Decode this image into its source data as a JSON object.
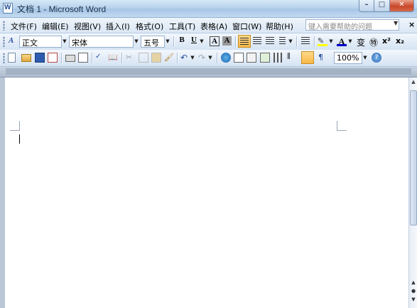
{
  "window": {
    "title": "文档 1 - Microsoft Word"
  },
  "menu": {
    "items": [
      "文件(F)",
      "编辑(E)",
      "视图(V)",
      "插入(I)",
      "格式(O)",
      "工具(T)",
      "表格(A)",
      "窗口(W)",
      "帮助(H)"
    ],
    "help_placeholder": "键入需要帮助的问题"
  },
  "formatting": {
    "style": "正文",
    "font": "宋体",
    "size": "五号",
    "bold": "B",
    "underline": "U",
    "char_border": "A",
    "char_shading": "A",
    "superscript": "x²",
    "subscript": "x₂"
  },
  "standard": {
    "zoom": "100%"
  },
  "colors": {
    "accent_highlight": "#f7b948",
    "title_bar": "#b8d3ec",
    "font_color_bar": "#0000cc"
  }
}
